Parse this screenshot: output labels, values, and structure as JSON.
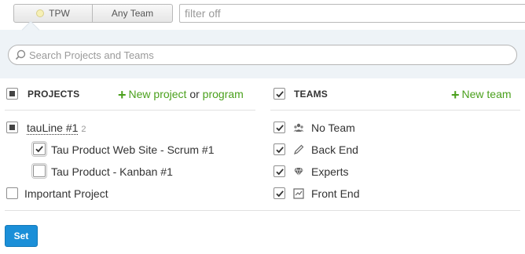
{
  "toolbar": {
    "segment_first_label": "TPW",
    "segment_second_label": "Any Team",
    "filter_placeholder": "filter off"
  },
  "search": {
    "placeholder": "Search Projects and Teams"
  },
  "projects": {
    "heading": "PROJECTS",
    "new_project_label": "New project",
    "or_text": "or",
    "program_label": "program",
    "program_item": {
      "label": "tauLine #1",
      "count": "2",
      "state": "partial"
    },
    "items": [
      {
        "label": "Tau Product Web Site - Scrum #1",
        "checked": true
      },
      {
        "label": "Tau Product - Kanban #1",
        "checked": false
      }
    ],
    "standalone": {
      "label": "Important Project",
      "checked": false
    }
  },
  "teams": {
    "heading": "TEAMS",
    "new_team_label": "New team",
    "items": [
      {
        "label": "No Team",
        "icon": "team-group-icon",
        "checked": true
      },
      {
        "label": "Back End",
        "icon": "pencil-icon",
        "checked": true
      },
      {
        "label": "Experts",
        "icon": "diamond-icon",
        "checked": true
      },
      {
        "label": "Front End",
        "icon": "chart-frame-icon",
        "checked": true
      }
    ]
  },
  "footer": {
    "set_label": "Set"
  },
  "colors": {
    "accent_green": "#4aa01c",
    "primary_blue": "#1b8fd8",
    "search_bg": "#eef3f7"
  }
}
